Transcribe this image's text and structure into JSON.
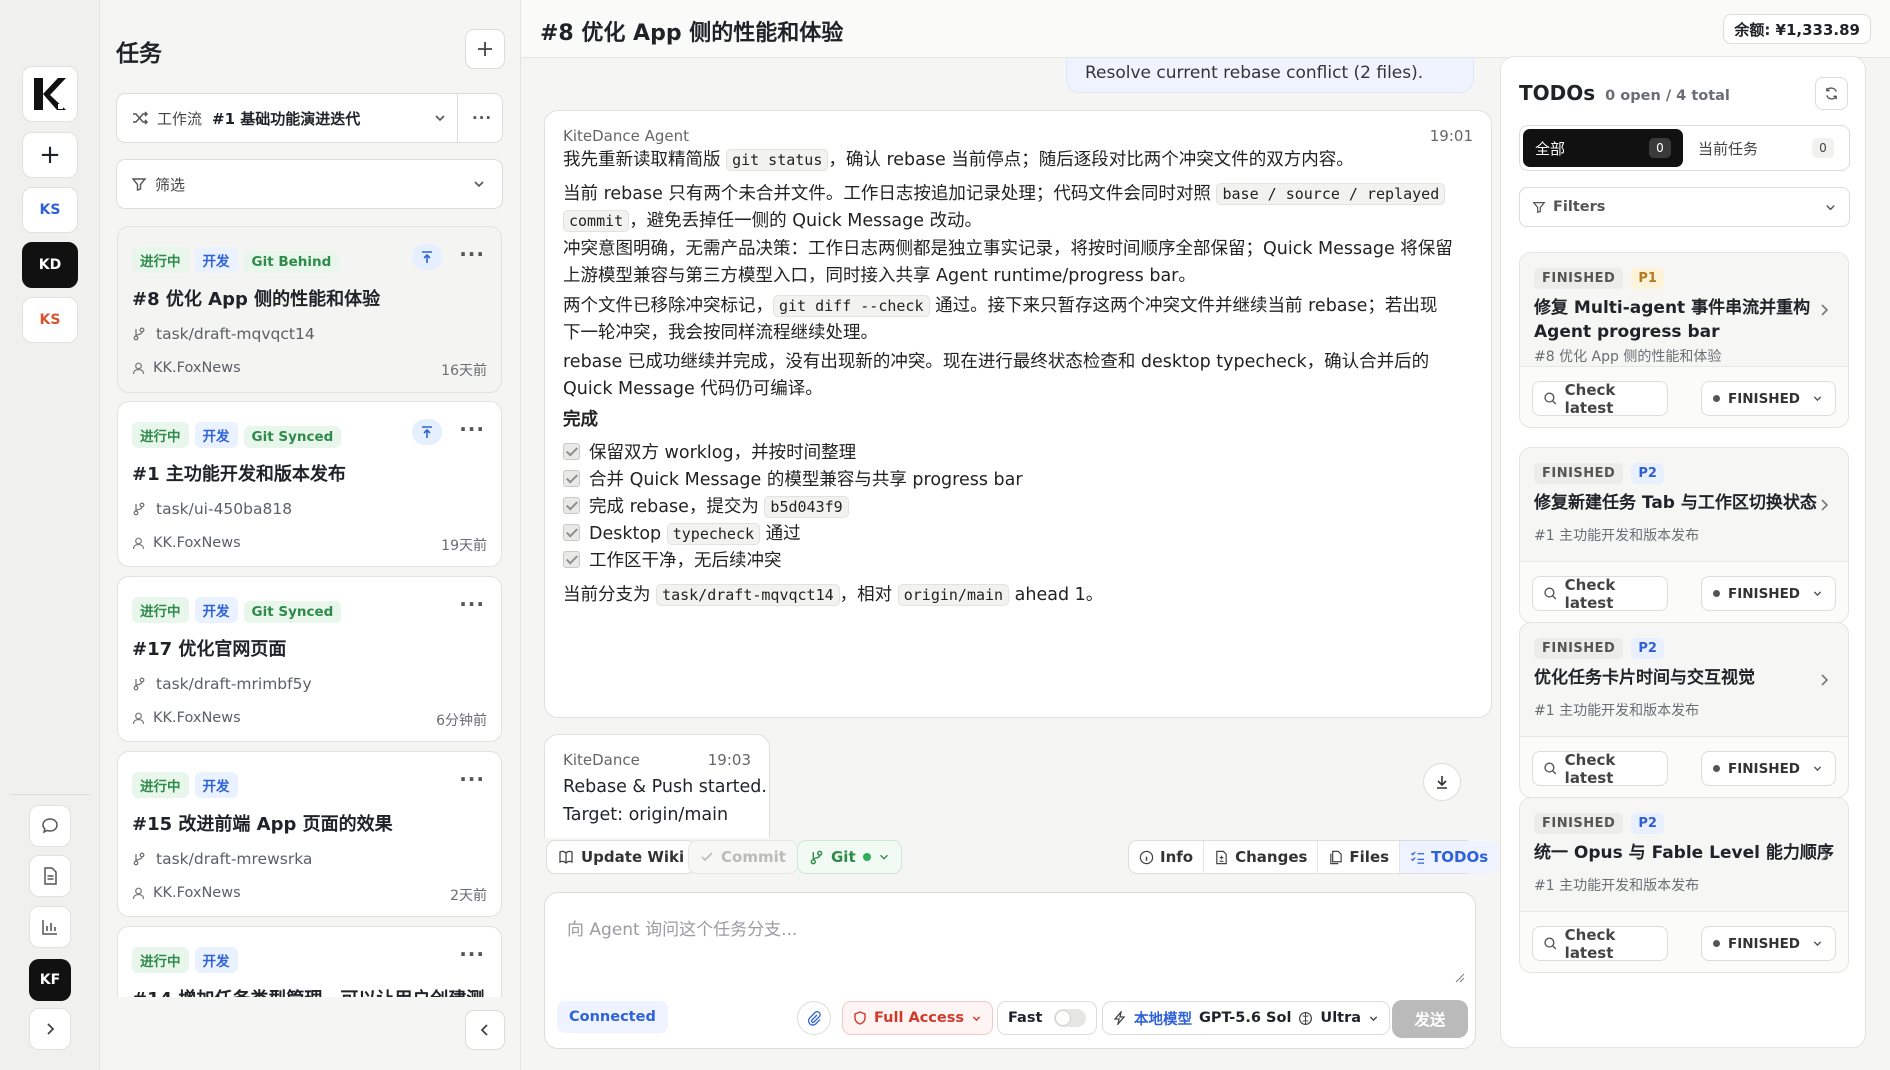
{
  "window": {
    "balance": "余额: ¥1,333.89"
  },
  "rail": {
    "logo": "K",
    "add": "+",
    "workspaces": [
      {
        "label": "KS",
        "color": "#2f62d9"
      },
      {
        "label": "KD",
        "color": "#ffffff",
        "active": true
      },
      {
        "label": "KS",
        "color": "#d9532f"
      }
    ],
    "user_avatar": "KF",
    "icons": [
      "chat-icon",
      "document-icon",
      "chart-icon",
      "expand-icon"
    ]
  },
  "tasks": {
    "title": "任务",
    "workflow_label": "工作流",
    "workflow_value": "#1 基础功能演进迭代",
    "filter_label": "筛选",
    "items": [
      {
        "status": "进行中",
        "type": "开发",
        "git": "Git Behind",
        "pinned": true,
        "title": "#8 优化 App 侧的性能和体验",
        "branch": "task/draft-mqvqct14",
        "user": "KK.FoxNews",
        "time": "16天前"
      },
      {
        "status": "进行中",
        "type": "开发",
        "git": "Git Synced",
        "pinned": true,
        "title": "#1 主功能开发和版本发布",
        "branch": "task/ui-450ba818",
        "user": "KK.FoxNews",
        "time": "19天前"
      },
      {
        "status": "进行中",
        "type": "开发",
        "git": "Git Synced",
        "pinned": false,
        "title": "#17 优化官网页面",
        "branch": "task/draft-mrimbf5y",
        "user": "KK.FoxNews",
        "time": "6分钟前"
      },
      {
        "status": "进行中",
        "type": "开发",
        "git": "",
        "pinned": false,
        "title": "#15 改进前端 App 页面的效果",
        "branch": "task/draft-mrewsrka",
        "user": "KK.FoxNews",
        "time": "2天前"
      },
      {
        "status": "进行中",
        "type": "开发",
        "git": "",
        "pinned": false,
        "title": "#14 增加任务类型管理，可以让用户创建测",
        "branch": "",
        "user": "",
        "time": ""
      }
    ]
  },
  "main": {
    "title": "#8 优化 App 侧的性能和体验",
    "prev_message": "Resolve current rebase conflict (2 files).",
    "agent": {
      "name": "KiteDance Agent",
      "time": "19:01",
      "p1a": "我先重新读取精简版 ",
      "p1code": "git status",
      "p1b": "，确认 rebase 当前停点；随后逐段对比两个冲突文件的双方内容。",
      "p2a": "当前 rebase 只有两个未合并文件。工作日志按追加记录处理；代码文件会同时对照 ",
      "p2code1": "base / source / replayed",
      "p2code2": "commit",
      "p2b": "，避免丢掉任一侧的 Quick Message 改动。",
      "p3a": "冲突意图明确，无需产品决策：工作日志两侧都是独立事实记录，将按时间顺序全部保留；Quick Message 将保留",
      "p3b": "上游模型兼容与第三方模型入口，同时接入共享 Agent runtime/progress bar。",
      "p4a": "两个文件已移除冲突标记，",
      "p4code": "git diff --check",
      "p4b": " 通过。接下来只暂存这两个冲突文件并继续当前 rebase；若出现",
      "p4c": "下一轮冲突，我会按同样流程继续处理。",
      "p5a": "rebase 已成功继续并完成，没有出现新的冲突。现在进行最终状态检查和 desktop typecheck，确认合并后的",
      "p5b": "Quick Message 代码仍可编译。",
      "done_heading": "完成",
      "check1": "保留双方 worklog，并按时间整理",
      "check2": "合并 Quick Message 的模型兼容与共享 progress bar",
      "check3a": "完成 rebase，提交为 ",
      "check3code": "b5d043f9",
      "check4a": "Desktop ",
      "check4code": "typecheck",
      "check4b": " 通过",
      "check5": "工作区干净，无后续冲突",
      "fa": "当前分支为 ",
      "fcode1": "task/draft-mqvqct14",
      "fb": "，相对 ",
      "fcode2": "origin/main",
      "fc": " ahead 1。"
    },
    "system": {
      "name": "KiteDance",
      "time": "19:03",
      "line1": "Rebase & Push started.",
      "line2": "Target: origin/main"
    },
    "toolbar": {
      "update_wiki": "Update Wiki",
      "commit": "Commit",
      "git": "Git",
      "info": "Info",
      "changes": "Changes",
      "files": "Files",
      "todos": "TODOs"
    },
    "composer": {
      "placeholder": "向 Agent 询问这个任务分支...",
      "connected": "Connected",
      "access": "Full Access",
      "fast": "Fast",
      "model_source": "本地模型",
      "model": "GPT-5.6 Sol",
      "effort": "Ultra",
      "send": "发送"
    }
  },
  "todos": {
    "title": "TODOs",
    "summary": "0 open / 4 total",
    "tab_all": "全部",
    "tab_all_count": "0",
    "tab_current": "当前任务",
    "tab_current_count": "0",
    "filters": "Filters",
    "check_latest": "Check latest",
    "items": [
      {
        "status": "FINISHED",
        "priority": "P1",
        "title1": "修复 Multi-agent 事件串流并重构",
        "title2": "Agent progress bar",
        "task": "#8 优化 App 侧的性能和体验",
        "state": "FINISHED"
      },
      {
        "status": "FINISHED",
        "priority": "P2",
        "title1": "修复新建任务 Tab 与工作区切换状态",
        "title2": "",
        "task": "#1 主功能开发和版本发布",
        "state": "FINISHED"
      },
      {
        "status": "FINISHED",
        "priority": "P2",
        "title1": "优化任务卡片时间与交互视觉",
        "title2": "",
        "task": "#1 主功能开发和版本发布",
        "state": "FINISHED"
      },
      {
        "status": "FINISHED",
        "priority": "P2",
        "title1": "统一 Opus 与 Fable Level 能力顺序",
        "title2": "",
        "task": "#1 主功能开发和版本发布",
        "state": "FINISHED"
      }
    ]
  }
}
